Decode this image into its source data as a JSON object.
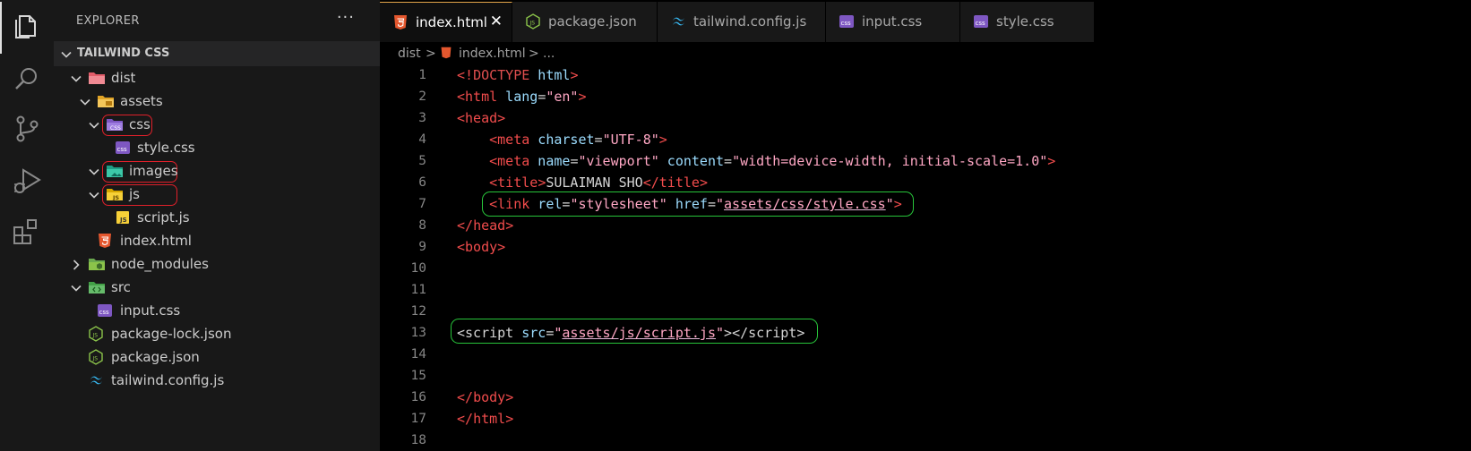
{
  "sidebar": {
    "header_title": "EXPLORER",
    "more_label": "···",
    "section_title": "TAILWIND CSS",
    "tree": [
      {
        "label": "dist"
      },
      {
        "label": "assets"
      },
      {
        "label": "css"
      },
      {
        "label": "style.css"
      },
      {
        "label": "images"
      },
      {
        "label": "js"
      },
      {
        "label": "script.js"
      },
      {
        "label": "index.html"
      },
      {
        "label": "node_modules"
      },
      {
        "label": "src"
      },
      {
        "label": "input.css"
      },
      {
        "label": "package-lock.json"
      },
      {
        "label": "package.json"
      },
      {
        "label": "tailwind.config.js"
      }
    ]
  },
  "tabs": [
    {
      "label": "index.html",
      "close": "✕"
    },
    {
      "label": "package.json"
    },
    {
      "label": "tailwind.config.js"
    },
    {
      "label": "input.css"
    },
    {
      "label": "style.css"
    }
  ],
  "breadcrumb": {
    "part1": "dist",
    "sep": ">",
    "part2": "index.html",
    "part3": "..."
  },
  "code": {
    "line_numbers": [
      "1",
      "2",
      "3",
      "4",
      "5",
      "6",
      "7",
      "8",
      "9",
      "10",
      "11",
      "12",
      "13",
      "14",
      "15",
      "16",
      "17",
      "18"
    ],
    "l1_open": "<!",
    "l1_kw": "DOCTYPE",
    "l1_attr": " html",
    "l1_close": ">",
    "l2_open": "<",
    "l2_tag": "html",
    "l2_attr": " lang",
    "l2_eq": "=",
    "l2_str": "\"en\"",
    "l2_close": ">",
    "l3_open": "<",
    "l3_tag": "head",
    "l3_close": ">",
    "l4_indent": "    ",
    "l4_open": "<",
    "l4_tag": "meta",
    "l4_attr": " charset",
    "l4_eq": "=",
    "l4_str": "\"UTF-8\"",
    "l4_close": ">",
    "l5_indent": "    ",
    "l5_open": "<",
    "l5_tag": "meta",
    "l5_attr1": " name",
    "l5_eq1": "=",
    "l5_str1": "\"viewport\"",
    "l5_attr2": " content",
    "l5_eq2": "=",
    "l5_str2": "\"width=device-width, initial-scale=1.0\"",
    "l5_close": ">",
    "l6_indent": "    ",
    "l6_open": "<",
    "l6_tag": "title",
    "l6_close": ">",
    "l6_text": "SULAIMAN SHO",
    "l6_end_open": "</",
    "l6_end_tag": "title",
    "l6_end_close": ">",
    "l7_indent": "    ",
    "l7_open": "<",
    "l7_tag": "link",
    "l7_attr1": " rel",
    "l7_eq1": "=",
    "l7_str1": "\"stylesheet\"",
    "l7_attr2": " href",
    "l7_eq2": "=",
    "l7_q1": "\"",
    "l7_link": "assets/css/style.css",
    "l7_q2": "\"",
    "l7_close": ">",
    "l8_open": "</",
    "l8_tag": "head",
    "l8_close": ">",
    "l9_open": "<",
    "l9_tag": "body",
    "l9_close": ">",
    "l13_open": "<",
    "l13_tag": "script",
    "l13_attr": " src",
    "l13_eq": "=",
    "l13_q1": "\"",
    "l13_link": "assets/js/script.js",
    "l13_q2": "\"",
    "l13_close": ">",
    "l13_end_open": "</",
    "l13_end_tag": "script",
    "l13_end_close": ">",
    "l16_open": "</",
    "l16_tag": "body",
    "l16_close": ">",
    "l17_open": "</",
    "l17_tag": "html",
    "l17_close": ">"
  }
}
